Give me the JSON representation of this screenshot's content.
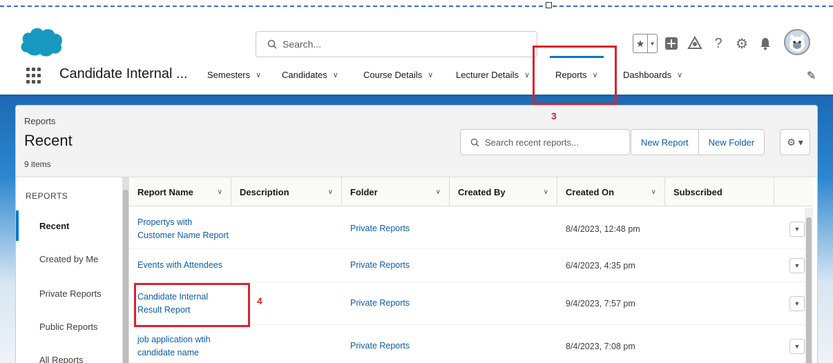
{
  "header": {
    "search_placeholder": "Search...",
    "icons": [
      "star-icon",
      "add-icon",
      "trailhead-icon",
      "help-icon",
      "setup-gear-icon",
      "notification-bell-icon"
    ]
  },
  "nav": {
    "app_name": "Candidate Internal ...",
    "items": [
      {
        "label": "Semesters"
      },
      {
        "label": "Candidates"
      },
      {
        "label": "Course Details"
      },
      {
        "label": "Lecturer Details"
      },
      {
        "label": "Reports"
      },
      {
        "label": "Dashboards"
      }
    ]
  },
  "page": {
    "breadcrumb": "Reports",
    "title": "Recent",
    "item_count": "9 items",
    "search_placeholder": "Search recent reports...",
    "buttons": {
      "new_report": "New Report",
      "new_folder": "New Folder"
    }
  },
  "sidebar": {
    "heading": "REPORTS",
    "items": [
      {
        "label": "Recent"
      },
      {
        "label": "Created by Me"
      },
      {
        "label": "Private Reports"
      },
      {
        "label": "Public Reports"
      },
      {
        "label": "All Reports"
      }
    ]
  },
  "table": {
    "columns": [
      "Report Name",
      "Description",
      "Folder",
      "Created By",
      "Created On",
      "Subscribed"
    ],
    "rows": [
      {
        "name_line1": "Propertys with",
        "name_line2": "Customer Name Report",
        "description": "",
        "folder": "Private Reports",
        "created_by": "",
        "created_on": "8/4/2023, 12:48 pm"
      },
      {
        "name_line1": "Events with Attendees",
        "name_line2": "",
        "description": "",
        "folder": "Private Reports",
        "created_by": "",
        "created_on": "6/4/2023, 4:35 pm"
      },
      {
        "name_line1": "Candidate Internal",
        "name_line2": "Result Report",
        "description": "",
        "folder": "Private Reports",
        "created_by": "",
        "created_on": "9/4/2023, 7:57 pm"
      },
      {
        "name_line1": "job application wtih",
        "name_line2": "candidate name",
        "description": "",
        "folder": "Private Reports",
        "created_by": "",
        "created_on": "8/4/2023, 7:08 pm"
      }
    ]
  },
  "annotations": {
    "step3": "3",
    "step4": "4"
  },
  "colors": {
    "brand_blue": "#0176d3",
    "link_blue": "#0b5cab",
    "annotation_red": "#d9232d",
    "cloud_blue": "#1798c1"
  }
}
